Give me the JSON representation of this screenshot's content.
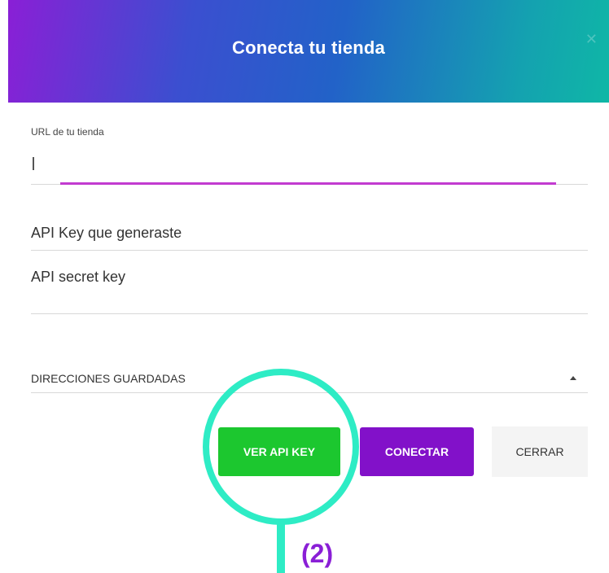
{
  "dialog": {
    "title": "Conecta tu tienda",
    "close_glyph": "✕"
  },
  "fields": {
    "url_label": "URL de tu tienda",
    "url_value": "",
    "api_key_placeholder": "API Key que generaste",
    "api_secret_placeholder": "API secret key"
  },
  "saved_addresses": {
    "label": "DIRECCIONES GUARDADAS"
  },
  "buttons": {
    "view_api_key": "VER API KEY",
    "connect": "CONECTAR",
    "close": "CERRAR"
  },
  "annotation": {
    "step": "(2)"
  },
  "colors": {
    "focus_line": "#c23bd0",
    "primary_green": "#1cc72f",
    "primary_purple": "#8211c9",
    "highlight_teal": "#2eecc5"
  }
}
